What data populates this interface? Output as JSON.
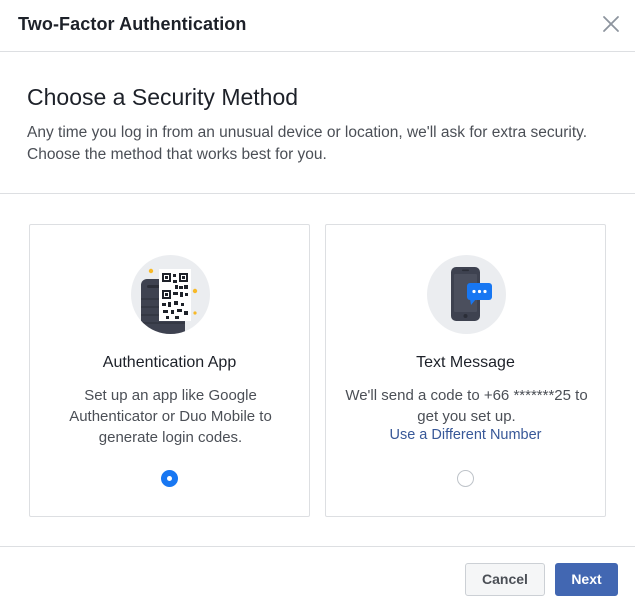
{
  "header": {
    "title": "Two-Factor Authentication",
    "close_icon": "close-icon"
  },
  "intro": {
    "title": "Choose a Security Method",
    "description": "Any time you log in from an unusual device or location, we'll ask for extra security. Choose the method that works best for you."
  },
  "methods": [
    {
      "title": "Authentication App",
      "description": "Set up an app like Google Authenticator or Duo Mobile to generate login codes.",
      "selected": true,
      "icon": "qr-phone-icon"
    },
    {
      "title": "Text Message",
      "description": "We'll send a code to +66 *******25 to get you set up.",
      "link": "Use a Different Number",
      "selected": false,
      "icon": "chat-phone-icon"
    }
  ],
  "footer": {
    "cancel_label": "Cancel",
    "next_label": "Next"
  },
  "colors": {
    "primary": "#4267b2",
    "radio": "#1877f2",
    "link": "#385898",
    "border": "#dddfe2"
  }
}
